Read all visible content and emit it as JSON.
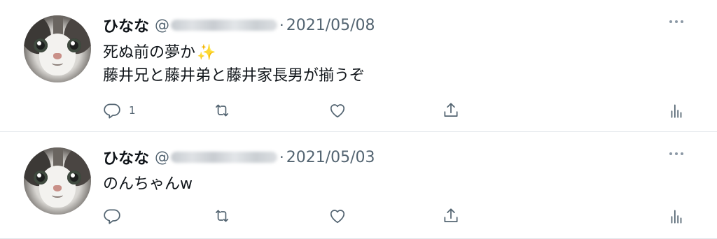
{
  "tweets": [
    {
      "user": {
        "name": "ひなな",
        "at": "@"
      },
      "separator": "·",
      "date": "2021/05/08",
      "text_line1": "死ぬ前の夢か",
      "emoji": "✨",
      "text_line2": "藤井兄と藤井弟と藤井家長男が揃うぞ",
      "reply_count": "1"
    },
    {
      "user": {
        "name": "ひなな",
        "at": "@"
      },
      "separator": "·",
      "date": "2021/05/03",
      "text_line1": "のんちゃんw"
    }
  ],
  "icons": [
    "avatar",
    "more-icon",
    "reply-icon",
    "retweet-icon",
    "like-icon",
    "share-icon",
    "stats-icon"
  ],
  "colors": {
    "text": "#0f1419",
    "secondary": "#536471",
    "icon": "#536471",
    "divider": "#e1e6ea"
  }
}
